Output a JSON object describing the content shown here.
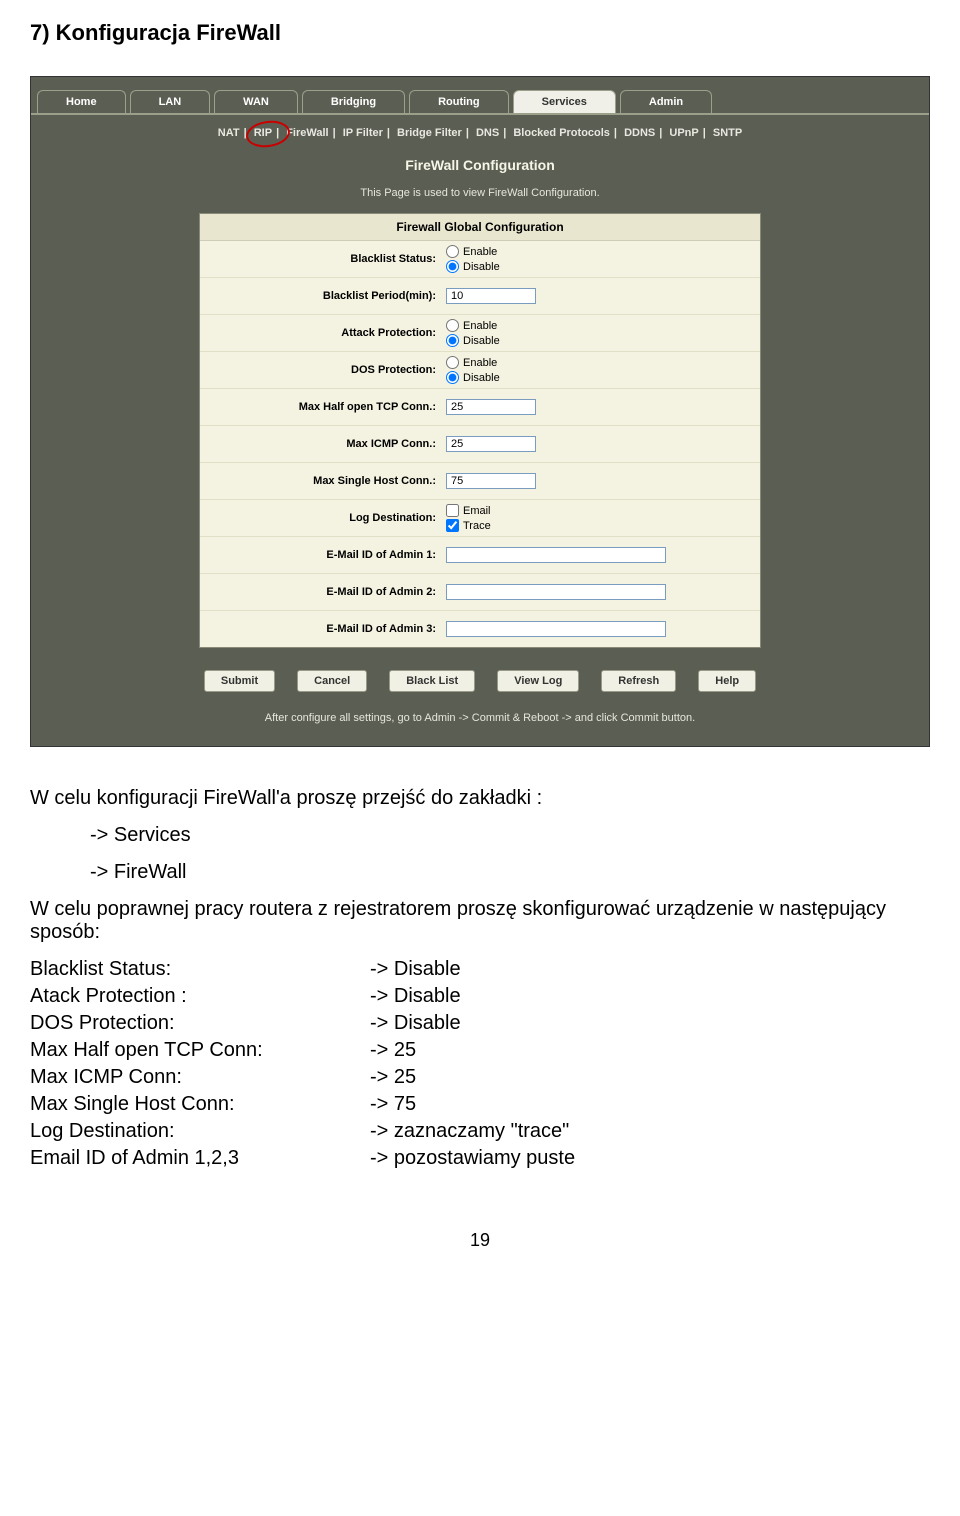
{
  "page_title": "7) Konfiguracja FireWall",
  "main_tabs": [
    "Home",
    "LAN",
    "WAN",
    "Bridging",
    "Routing",
    "Services",
    "Admin"
  ],
  "main_tab_active": "Services",
  "sub_tabs": [
    "NAT",
    "RIP",
    "FireWall",
    "IP Filter",
    "Bridge Filter",
    "DNS",
    "Blocked Protocols",
    "DDNS",
    "UPnP",
    "SNTP"
  ],
  "sub_tab_circled": "RIP",
  "panel_title": "FireWall Configuration",
  "panel_desc": "This Page is used to view FireWall Configuration.",
  "config_header": "Firewall Global Configuration",
  "rows": {
    "blacklist_status_label": "Blacklist Status:",
    "blacklist_status_enable": "Enable",
    "blacklist_status_disable": "Disable",
    "blacklist_period_label": "Blacklist Period(min):",
    "blacklist_period_value": "10",
    "attack_protection_label": "Attack Protection:",
    "dos_protection_label": "DOS Protection:",
    "max_half_open_label": "Max Half open TCP Conn.:",
    "max_half_open_value": "25",
    "max_icmp_label": "Max ICMP Conn.:",
    "max_icmp_value": "25",
    "max_single_host_label": "Max Single Host Conn.:",
    "max_single_host_value": "75",
    "log_dest_label": "Log Destination:",
    "log_dest_email": "Email",
    "log_dest_trace": "Trace",
    "email1_label": "E-Mail ID of Admin 1:",
    "email2_label": "E-Mail ID of Admin 2:",
    "email3_label": "E-Mail ID of Admin 3:"
  },
  "buttons": [
    "Submit",
    "Cancel",
    "Black List",
    "View Log",
    "Refresh",
    "Help"
  ],
  "commit_note": "After configure all settings, go to Admin -> Commit & Reboot -> and click Commit button.",
  "body": {
    "intro": "W celu konfiguracji FireWall'a proszę przejść do zakładki :",
    "path1": "-> Services",
    "path2": "-> FireWall",
    "instr": "W celu poprawnej pracy routera z rejestratorem proszę skonfigurować urządzenie w następujący sposób:",
    "settings": [
      {
        "k": "Blacklist Status:",
        "v": "-> Disable"
      },
      {
        "k": "Atack Protection :",
        "v": "-> Disable"
      },
      {
        "k": "DOS Protection:",
        "v": "-> Disable"
      },
      {
        "k": "Max Half open TCP Conn:",
        "v": "-> 25"
      },
      {
        "k": "Max ICMP Conn:",
        "v": "-> 25"
      },
      {
        "k": "Max Single Host Conn:",
        "v": "-> 75"
      },
      {
        "k": "Log Destination:",
        "v": "-> zaznaczamy \"trace\""
      },
      {
        "k": "Email ID of Admin 1,2,3",
        "v": "-> pozostawiamy puste"
      }
    ]
  },
  "page_number": "19"
}
